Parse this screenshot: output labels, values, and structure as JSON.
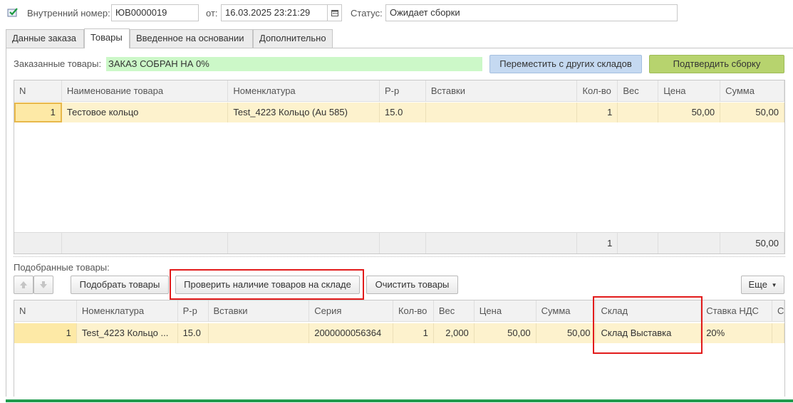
{
  "header": {
    "internal_label": "Внутренний номер:",
    "internal_value": "ЮВ0000019",
    "date_label": "от:",
    "date_value": "16.03.2025 23:21:29",
    "status_label": "Статус:",
    "status_value": "Ожидает сборки"
  },
  "tabs": [
    {
      "label": "Данные заказа"
    },
    {
      "label": "Товары"
    },
    {
      "label": "Введенное на основании"
    },
    {
      "label": "Дополнительно"
    }
  ],
  "ordered": {
    "label": "Заказанные товары:",
    "progress_text": "ЗАКАЗ СОБРАН НА 0%",
    "move_button": "Переместить с других складов",
    "confirm_button": "Подтвердить сборку",
    "columns": [
      "N",
      "Наименование товара",
      "Номенклатура",
      "Р-р",
      "Вставки",
      "Кол-во",
      "Вес",
      "Цена",
      "Сумма"
    ],
    "rows": [
      [
        "1",
        "Тестовое кольцо",
        "Test_4223 Кольцо (Au 585)",
        "15.0",
        "",
        "1",
        "",
        "50,00",
        "50,00"
      ]
    ],
    "footer": [
      "",
      "",
      "",
      "",
      "",
      "1",
      "",
      "",
      "50,00"
    ]
  },
  "picked": {
    "label": "Подобранные товары:",
    "pick_button": "Подобрать товары",
    "check_button": "Проверить наличие товаров на складе",
    "clear_button": "Очистить товары",
    "more_button": "Еще",
    "columns": [
      "N",
      "Номенклатура",
      "Р-р",
      "Вставки",
      "Серия",
      "Кол-во",
      "Вес",
      "Цена",
      "Сумма",
      "Склад",
      "Ставка НДС",
      "С"
    ],
    "rows": [
      [
        "1",
        "Test_4223 Кольцо ...",
        "15.0",
        "",
        "2000000056364",
        "1",
        "2,000",
        "50,00",
        "50,00",
        "Склад Выставка",
        "20%",
        ""
      ]
    ]
  },
  "colors": {
    "accent_green": "#1e9b4c",
    "highlight_red": "#e21b1b",
    "row_yellow": "#fdf2cd",
    "progress_green": "#ccf8c8"
  },
  "icons": {
    "doc": "document-check-icon",
    "calendar": "calendar-icon",
    "up": "arrow-up-icon",
    "down": "arrow-down-icon",
    "more": "chevron-down-icon"
  }
}
